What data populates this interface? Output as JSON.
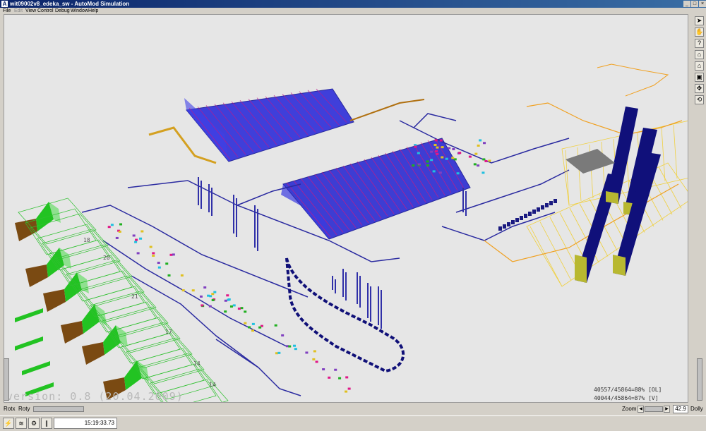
{
  "window": {
    "title": "wit09002v8_edeka_sw - AutoMod Simulation",
    "app_icon": "automod-app-icon"
  },
  "menu": {
    "items": [
      {
        "id": "file",
        "label": "File"
      },
      {
        "id": "edit",
        "label": "Edit"
      },
      {
        "id": "view",
        "label": "View"
      },
      {
        "id": "control",
        "label": "Control"
      },
      {
        "id": "debug",
        "label": "Debug"
      },
      {
        "id": "window",
        "label": "Window"
      },
      {
        "id": "help",
        "label": "Help"
      }
    ]
  },
  "viewport": {
    "version_text": "version: 0.8 (20.04.2009)",
    "stats": [
      "40557/45864=88% [OL]",
      "40044/45864=87% [V]"
    ],
    "row_numbers": [
      "18",
      "20",
      "21",
      "17",
      "14",
      "14"
    ],
    "colors": {
      "rack_blue": "#1c1cc8",
      "rack_magenta": "#e0107a",
      "conveyor_navy": "#101078",
      "building_green": "#22c322",
      "building_brown": "#7a4a12",
      "orange": "#f0a020",
      "yellow": "#f4e040",
      "background": "#e6e6e6"
    }
  },
  "right_toolbar": {
    "tools": [
      {
        "id": "select",
        "icon": "arrow-cursor-icon"
      },
      {
        "id": "pan",
        "icon": "hand-icon"
      },
      {
        "id": "query",
        "icon": "question-icon"
      },
      {
        "id": "home",
        "icon": "home-icon"
      },
      {
        "id": "home-reset",
        "icon": "home-arrow-icon"
      },
      {
        "id": "zoom-box",
        "icon": "zoom-box-icon"
      },
      {
        "id": "move",
        "icon": "move-icon"
      },
      {
        "id": "rotate",
        "icon": "rotate-icon"
      }
    ]
  },
  "bottom": {
    "rotx_label": "Rotx",
    "roty_label": "Roty",
    "zoom_label": "Zoom",
    "zoom_value": "42.9",
    "dolly_label": "Dolly"
  },
  "status": {
    "time": "15:19:33.73"
  }
}
